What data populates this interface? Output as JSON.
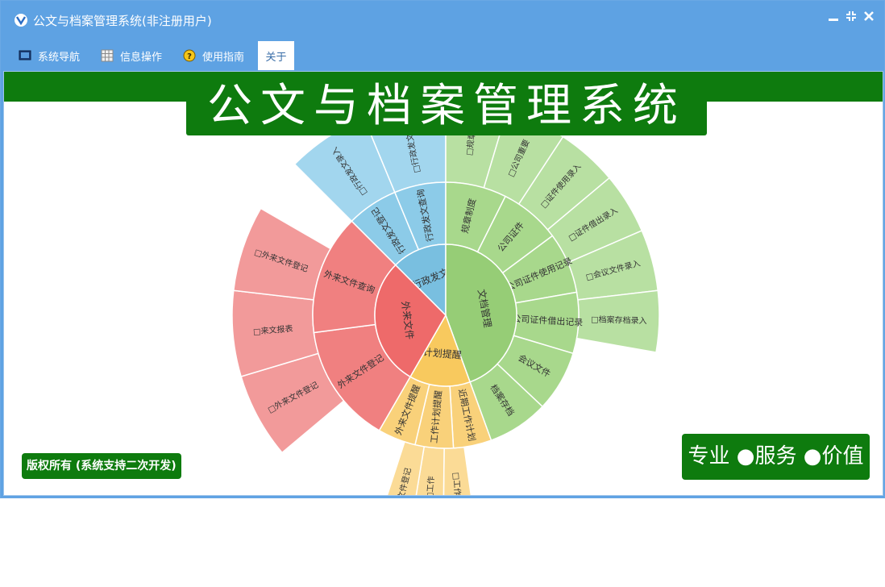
{
  "window": {
    "title": "公文与档案管理系统(非注册用户)",
    "controls": {
      "minimize_icon": "minimize-icon",
      "restore_icon": "restore-icon",
      "close_icon": "close-icon"
    }
  },
  "menu": [
    {
      "label": "系统导航",
      "icon": "monitor-icon"
    },
    {
      "label": "信息操作",
      "icon": "grid-icon"
    },
    {
      "label": "使用指南",
      "icon": "help-icon"
    },
    {
      "label": "关于",
      "icon": ""
    }
  ],
  "banner": {
    "title": "公文与档案管理系统"
  },
  "footer": {
    "copyright": "版权所有 (系统支持二次开发)",
    "slogan": "专业 ●服务 ●价值"
  },
  "colors": {
    "titlebar": "#5ea2e3",
    "brand_green": "#0e7b0e",
    "gray_red": "#ee6a6a",
    "blue": "#79bfe0",
    "green": "#96cd76",
    "orange": "#f8c95e"
  },
  "chart_data": {
    "type": "sunburst",
    "inner": [
      {
        "name": "行政发文",
        "share": 0.125
      },
      {
        "name": "文档管理",
        "share": 0.5
      },
      {
        "name": "计划提醒",
        "share": 0.1667
      },
      {
        "name": "外来文件",
        "share": 0.2083
      }
    ],
    "middle": [
      {
        "parent": "行政发文",
        "items": [
          "行政发文登记",
          "行政发文查询"
        ]
      },
      {
        "parent": "文档管理",
        "items": [
          "规章制度",
          "公司证件",
          "公司证件使用记录",
          "公司证件借出记录",
          "会议文件",
          "档案存档"
        ]
      },
      {
        "parent": "计划提醒",
        "items": [
          "近期工作计划",
          "工作计划提醒",
          "外来文件提醒"
        ]
      },
      {
        "parent": "外来文件",
        "items": [
          "外来文件登记",
          "外来文件查询"
        ]
      }
    ],
    "outer": [
      {
        "parent": "行政发文",
        "items": [
          "□行政发文录入",
          "□行政发文报表"
        ]
      },
      {
        "parent": "文档管理",
        "items": [
          "□规章",
          "□公司重要",
          "□证件使用录入",
          "□证件借出录入",
          "□会议文件录入",
          "□档案存档录入"
        ]
      },
      {
        "parent": "计划提醒",
        "items": [
          "□工作计",
          "□工作",
          "文件登记"
        ]
      },
      {
        "parent": "外来文件",
        "items": [
          "□外来文件登记",
          "□来文报表",
          "□外来文件登记"
        ]
      }
    ]
  }
}
